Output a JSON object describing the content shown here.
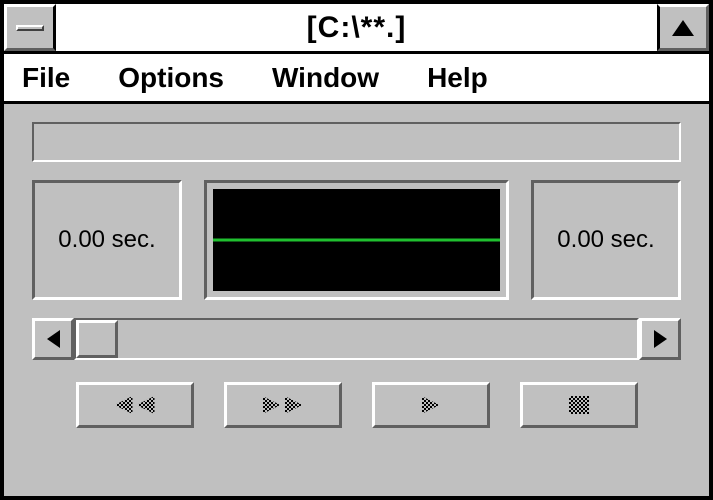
{
  "title": "[C:\\**.]",
  "menu": {
    "file": "File",
    "options": "Options",
    "window": "Window",
    "help": "Help"
  },
  "time": {
    "left": "0.00 sec.",
    "right": "0.00 sec."
  },
  "colors": {
    "waveform_bg": "#000000",
    "waveform_line": "#20c030"
  },
  "transport": {
    "rewind": "rewind",
    "fast_forward": "fast-forward",
    "play": "play",
    "stop": "stop"
  }
}
